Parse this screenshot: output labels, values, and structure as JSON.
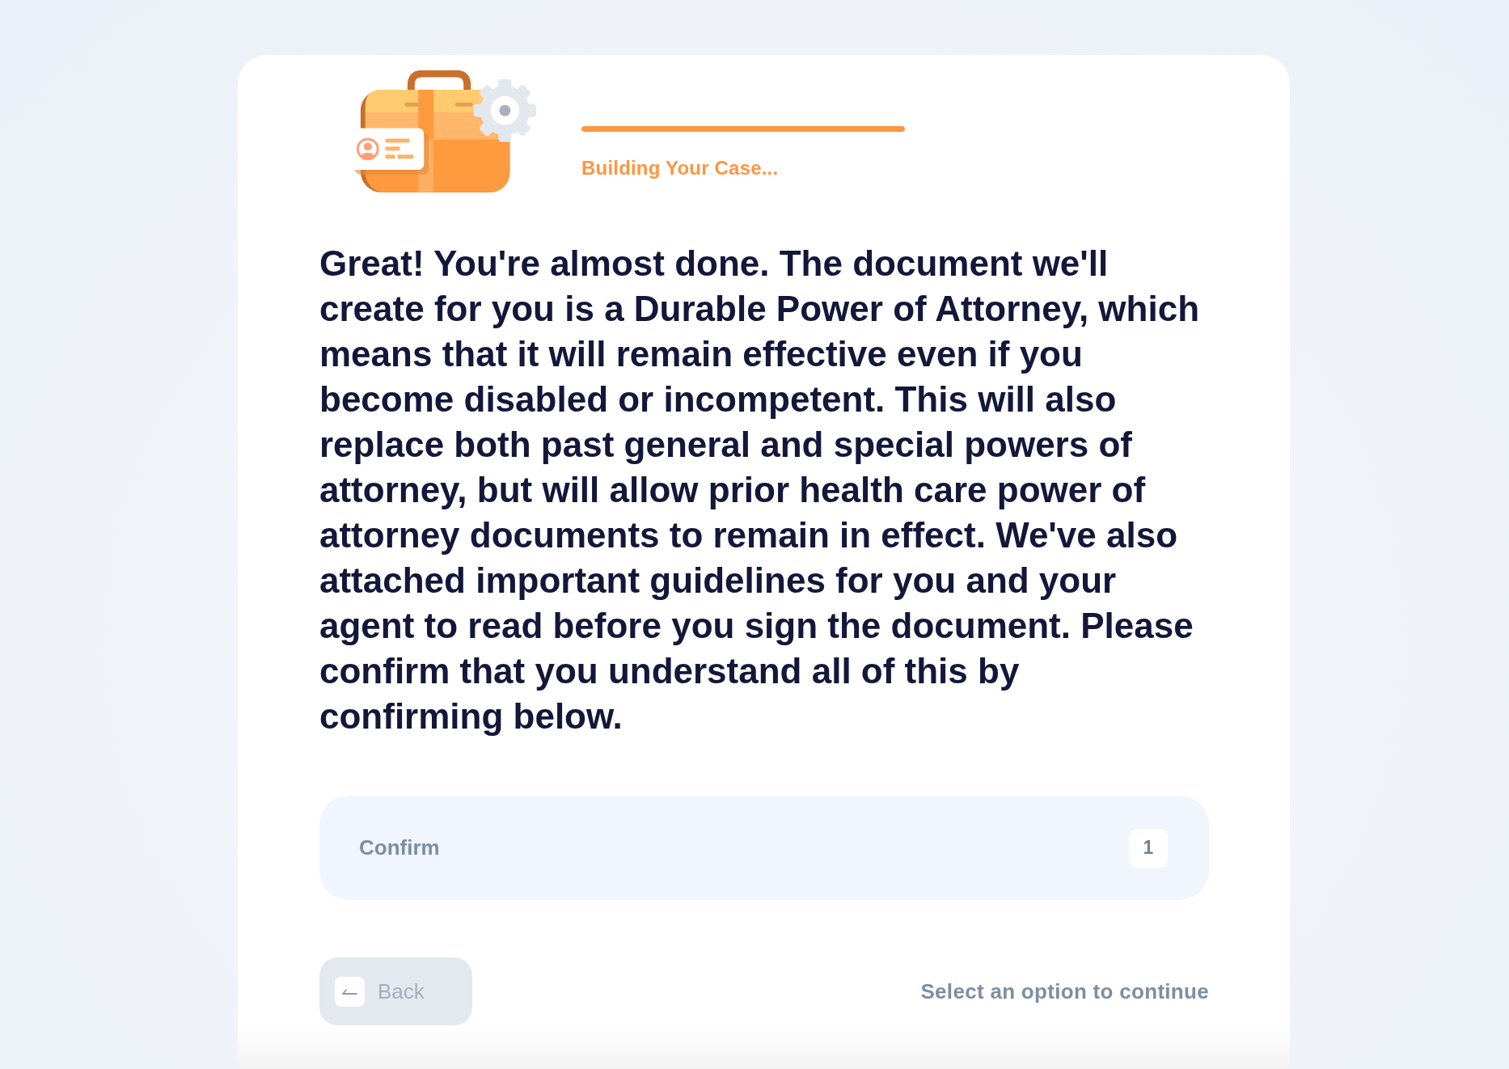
{
  "progress": {
    "level": 1,
    "label": "Building Your Case..."
  },
  "question": {
    "text": "Great! You're almost done. The document we'll create for you is a Durable Power of Attorney, which means that it will remain effective even if you become disabled or incompetent. This will also replace both past general and special powers of attorney, but will allow prior health care power of attorney documents to remain in effect. We've also attached important guidelines for you and your agent to read before you sign the document. Please confirm that you understand all of this by confirming below."
  },
  "options": [
    {
      "label": "Confirm",
      "key": "1",
      "selected": false
    }
  ],
  "footer": {
    "back_button": {
      "label": "Back",
      "disabled": true
    },
    "hint": "Select an option to continue"
  }
}
